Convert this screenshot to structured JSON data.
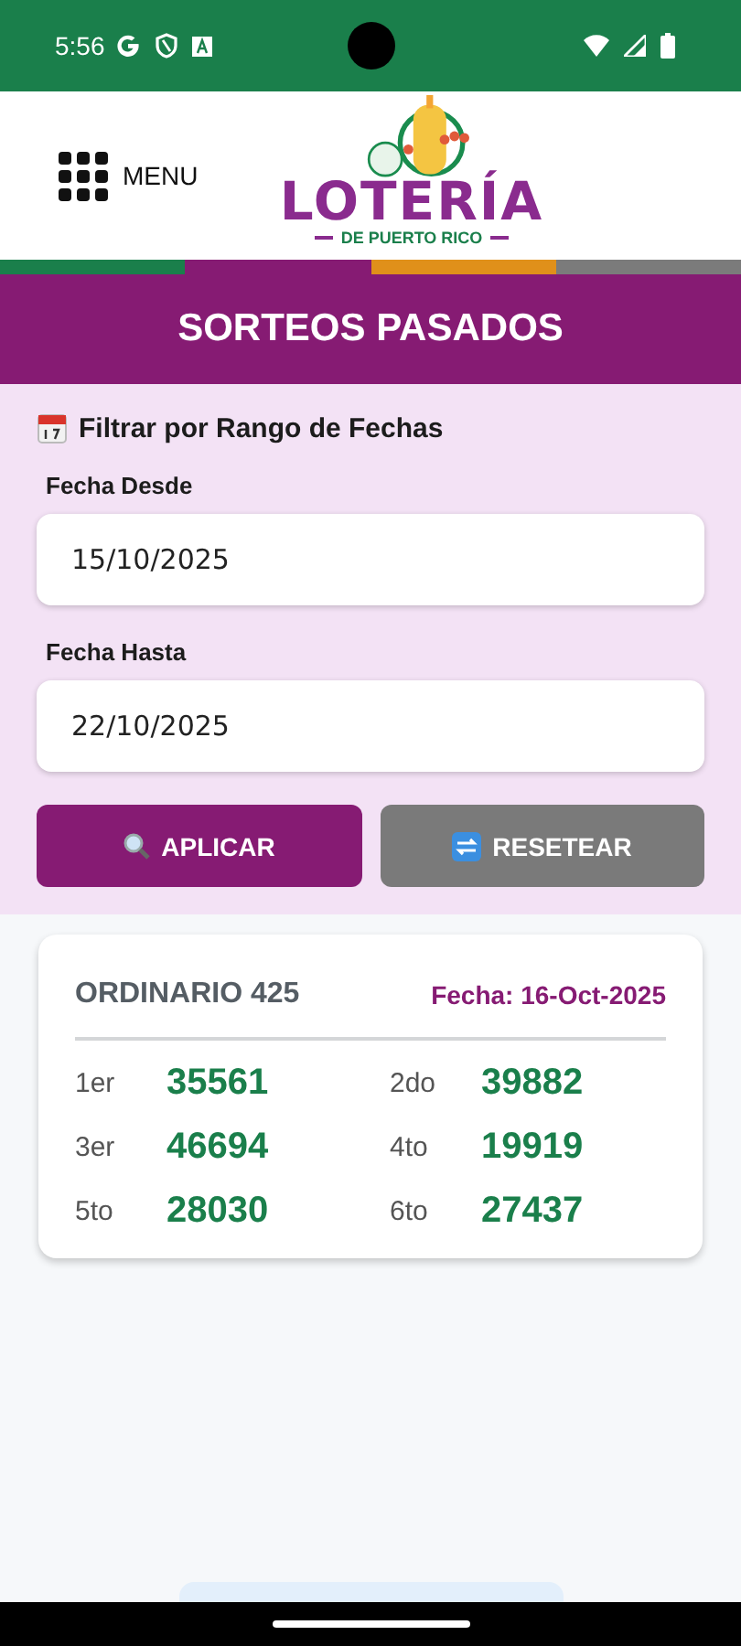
{
  "status_bar": {
    "time": "5:56"
  },
  "header": {
    "menu_label": "MENU",
    "logo_title": "LOTERÍA",
    "logo_subtitle": "DE PUERTO RICO"
  },
  "page_title": "SORTEOS PASADOS",
  "filter": {
    "heading": "Filtrar por Rango de Fechas",
    "fields": [
      {
        "label": "Fecha Desde",
        "value": "15/10/2025"
      },
      {
        "label": "Fecha Hasta",
        "value": "22/10/2025"
      }
    ],
    "buttons": [
      {
        "kind": "apply",
        "label": "APLICAR"
      },
      {
        "kind": "reset",
        "label": "RESETEAR"
      }
    ]
  },
  "results": [
    {
      "title": "ORDINARIO 425",
      "date": "Fecha: 16-Oct-2025",
      "prizes": [
        {
          "place": "1er",
          "number": "35561"
        },
        {
          "place": "2do",
          "number": "39882"
        },
        {
          "place": "3er",
          "number": "46694"
        },
        {
          "place": "4to",
          "number": "19919"
        },
        {
          "place": "5to",
          "number": "28030"
        },
        {
          "place": "6to",
          "number": "27437"
        }
      ]
    }
  ]
}
